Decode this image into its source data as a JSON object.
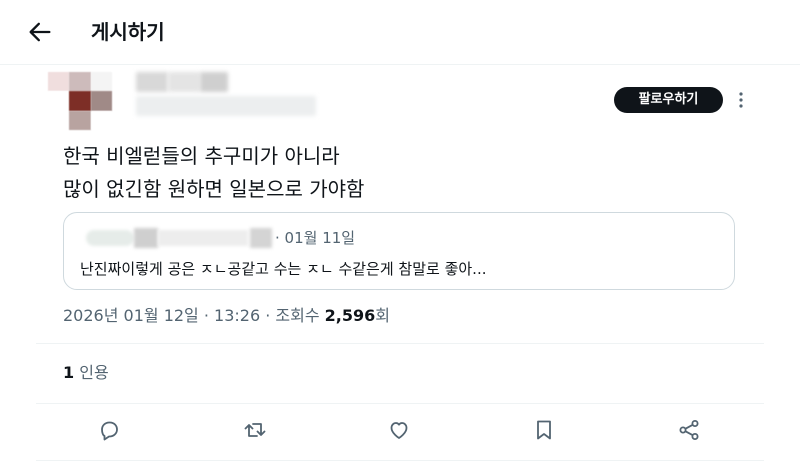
{
  "header": {
    "title": "게시하기",
    "back_icon": "arrow-left-icon"
  },
  "post": {
    "follow_label": "팔로우하기",
    "text_line1": "한국 비엘럳들의 추구미가 아니라",
    "text_line2": "많이 없긴함 원하면 일본으로 가야함",
    "quote": {
      "date": "· 01월 11일",
      "text": "난진짜이렇게 공은 ㅈㄴ공같고 수는 ㅈㄴ 수같은게 참말로 좋아..."
    },
    "meta": {
      "date": "2026년 01월 12일",
      "time": "· 13:26 · 조회수",
      "views": "2,596",
      "views_suffix": "회"
    },
    "quotes": {
      "count": "1",
      "label": "인용"
    }
  },
  "actions": [
    "reply-icon",
    "repost-icon",
    "like-icon",
    "bookmark-icon",
    "share-icon"
  ],
  "colors": {
    "text": "#0f1419",
    "secondary": "#536471",
    "border": "#cfd9de",
    "follow_bg": "#0f1419"
  }
}
